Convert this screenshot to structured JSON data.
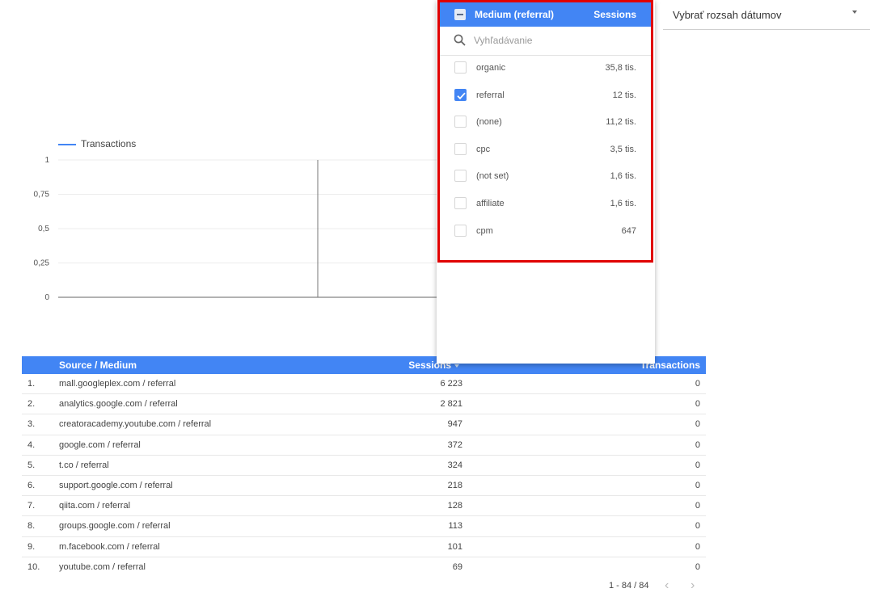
{
  "date_range": {
    "label": "Vybrať rozsah dátumov"
  },
  "chart_data": {
    "type": "line",
    "series": [
      {
        "name": "Transactions",
        "color": "#4285f4",
        "values": []
      }
    ],
    "yticks": [
      "1",
      "0,75",
      "0,5",
      "0,25",
      "0"
    ],
    "ylim": [
      0,
      1
    ],
    "grid": true,
    "legend": "top-left"
  },
  "table": {
    "headers": {
      "source": "Source / Medium",
      "sessions": "Sessions",
      "transactions": "Transactions"
    },
    "rows": [
      {
        "idx": "1.",
        "source": "mall.googleplex.com / referral",
        "sessions": "6 223",
        "transactions": "0"
      },
      {
        "idx": "2.",
        "source": "analytics.google.com / referral",
        "sessions": "2 821",
        "transactions": "0"
      },
      {
        "idx": "3.",
        "source": "creatoracademy.youtube.com / referral",
        "sessions": "947",
        "transactions": "0"
      },
      {
        "idx": "4.",
        "source": "google.com / referral",
        "sessions": "372",
        "transactions": "0"
      },
      {
        "idx": "5.",
        "source": "t.co / referral",
        "sessions": "324",
        "transactions": "0"
      },
      {
        "idx": "6.",
        "source": "support.google.com / referral",
        "sessions": "218",
        "transactions": "0"
      },
      {
        "idx": "7.",
        "source": "qiita.com / referral",
        "sessions": "128",
        "transactions": "0"
      },
      {
        "idx": "8.",
        "source": "groups.google.com / referral",
        "sessions": "113",
        "transactions": "0"
      },
      {
        "idx": "9.",
        "source": "m.facebook.com / referral",
        "sessions": "101",
        "transactions": "0"
      },
      {
        "idx": "10.",
        "source": "youtube.com / referral",
        "sessions": "69",
        "transactions": "0"
      }
    ],
    "pagination": "1 - 84 / 84"
  },
  "filter": {
    "title": "Medium (referral)",
    "metric": "Sessions",
    "search_placeholder": "Vyhľadávanie",
    "items": [
      {
        "name": "organic",
        "value": "35,8 tis.",
        "checked": false
      },
      {
        "name": "referral",
        "value": "12 tis.",
        "checked": true
      },
      {
        "name": "(none)",
        "value": "11,2 tis.",
        "checked": false
      },
      {
        "name": "cpc",
        "value": "3,5 tis.",
        "checked": false
      },
      {
        "name": "(not set)",
        "value": "1,6 tis.",
        "checked": false
      },
      {
        "name": "affiliate",
        "value": "1,6 tis.",
        "checked": false
      },
      {
        "name": "cpm",
        "value": "647",
        "checked": false
      }
    ]
  }
}
